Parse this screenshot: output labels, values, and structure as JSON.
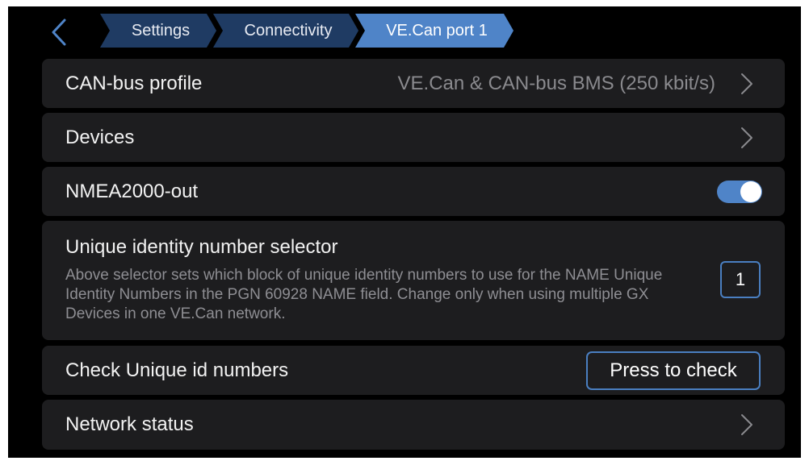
{
  "colors": {
    "background": "#000000",
    "row_background": "#1d1d1f",
    "accent": "#4a7fc1",
    "breadcrumb_inactive": "#1f3b63",
    "breadcrumb_active": "#4f84c8",
    "toggle_on": "#4f84c8",
    "secondary_text": "#8a8a8e"
  },
  "nav": {
    "back_icon": "chevron-left-icon",
    "breadcrumbs": [
      {
        "label": "Settings"
      },
      {
        "label": "Connectivity"
      },
      {
        "label": "VE.Can port 1"
      }
    ]
  },
  "rows": {
    "canbus_profile": {
      "label": "CAN-bus profile",
      "value": "VE.Can & CAN-bus BMS (250 kbit/s)",
      "icon": "chevron-right-icon"
    },
    "devices": {
      "label": "Devices",
      "icon": "chevron-right-icon"
    },
    "nmea2000_out": {
      "label": "NMEA2000-out",
      "enabled": true
    },
    "unique_identity": {
      "label": "Unique identity number selector",
      "description": "Above selector sets which block of unique identity numbers to use for the NAME Unique Identity Numbers in the PGN 60928 NAME field. Change only when using multiple GX Devices in one VE.Can network.",
      "value": "1"
    },
    "check_unique": {
      "label": "Check Unique id numbers",
      "button_label": "Press to check"
    },
    "network_status": {
      "label": "Network status",
      "icon": "chevron-right-icon"
    }
  }
}
